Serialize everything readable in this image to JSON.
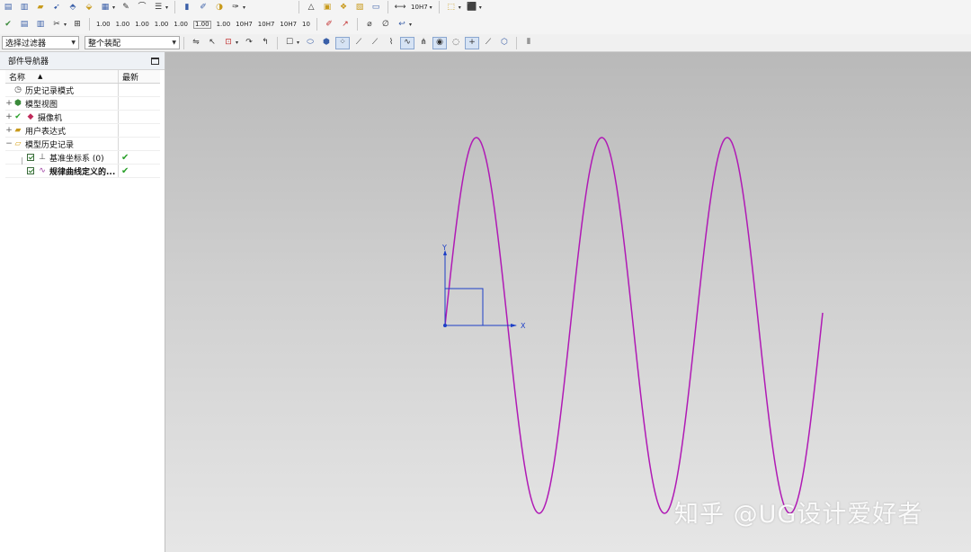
{
  "toolbar": {
    "dim_labels": [
      "1.00",
      "1.00",
      "1.00",
      "1.00",
      "1.00",
      "1.00",
      "1.00",
      "10H7",
      "10H7",
      "10H7",
      "10"
    ],
    "tol_label_top": "10H7",
    "selection_filter": "选择过滤器",
    "assembly_scope": "整个装配"
  },
  "navigator": {
    "title": "部件导航器",
    "col_name": "名称",
    "col_latest": "最新",
    "items": [
      {
        "label": "历史记录模式",
        "expander": "",
        "latest": ""
      },
      {
        "label": "模型视图",
        "expander": "+",
        "latest": ""
      },
      {
        "label": "摄像机",
        "expander": "+",
        "latest": ""
      },
      {
        "label": "用户表达式",
        "expander": "+",
        "latest": ""
      },
      {
        "label": "模型历史记录",
        "expander": "−",
        "latest": ""
      }
    ],
    "features": [
      {
        "label": "基准坐标系 (0)",
        "latest": "✔"
      },
      {
        "label": "规律曲线定义的...",
        "latest": "✔"
      }
    ]
  },
  "viewport": {
    "curve_color": "#b01ab5",
    "csys_color": "#1d3fc7",
    "axis_x_label": "X",
    "axis_y_label": "Y",
    "watermark": "知乎 @UG设计爱好者"
  }
}
